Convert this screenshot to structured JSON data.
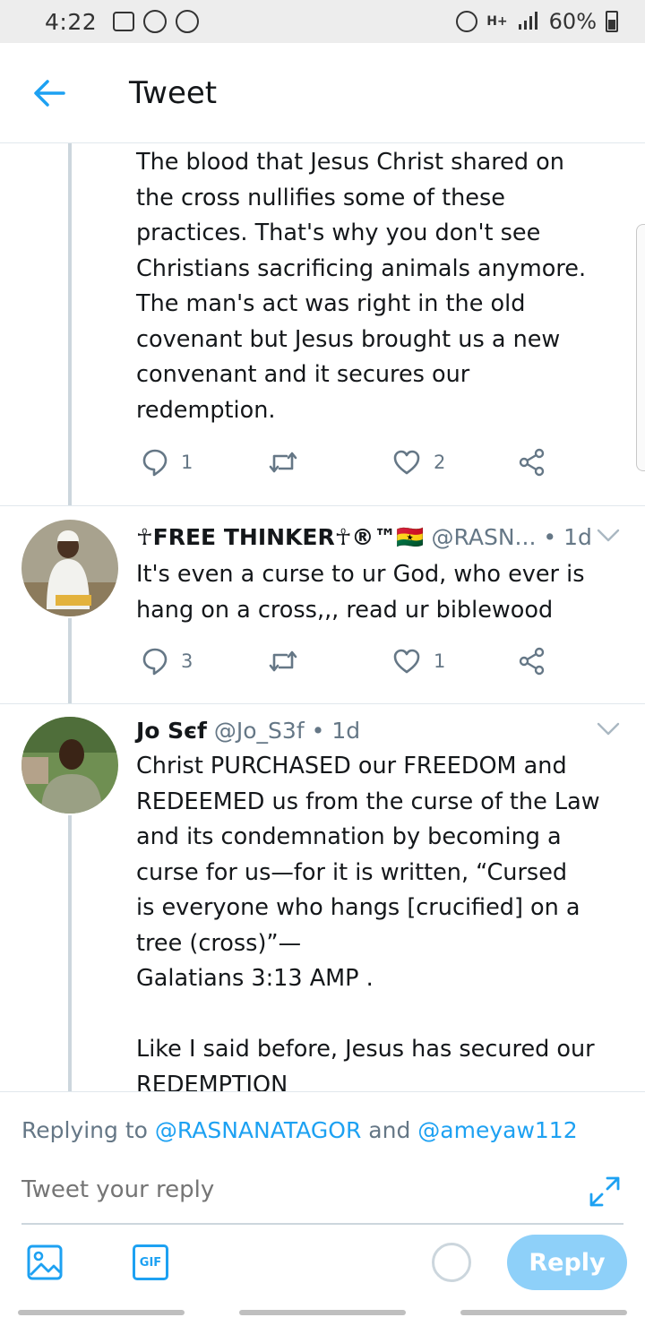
{
  "status_bar": {
    "time": "4:22",
    "battery": "60%",
    "network": "H+"
  },
  "header": {
    "title": "Tweet"
  },
  "tweets": [
    {
      "text": "The blood that Jesus Christ shared on\nthe cross nullifies some of these\npractices. That's why you don't see\nChristians sacrificing animals anymore.\nThe man's act was right in the old\ncovenant but Jesus brought us a new\nconvenant and it secures our\nredemption.",
      "replies": "1",
      "likes": "2"
    },
    {
      "name": "☥FREE THINKER☥®™🇬🇭",
      "handle": "@RASN...",
      "time": "• 1d",
      "text": "It's even a curse to ur God, who ever is\nhang on a cross,,, read ur biblewood",
      "replies": "3",
      "likes": "1"
    },
    {
      "name": "Jo Sєf",
      "handle": "@Jo_S3f",
      "time": "• 1d",
      "text": "Christ PURCHASED our FREEDOM and\nREDEEMED us from the curse of the Law\nand its condemnation by becoming a\ncurse for us—for it is written, “Cursed\nis everyone who hangs [crucified] on a\ntree (cross)”—\nGalatians 3:13 AMP .\n\nLike I said before, Jesus has secured our\nREDEMPTION"
    }
  ],
  "composer": {
    "replying_prefix": "Replying to",
    "mention_1": "@RASNANATAGOR",
    "and": "and",
    "mention_2": "@ameyaw112",
    "placeholder": "Tweet your reply",
    "gif_label": "GIF",
    "reply_label": "Reply"
  },
  "colors": {
    "accent": "#1da1f2",
    "reply_button": "#8ed0f9",
    "secondary_text": "#657786"
  }
}
